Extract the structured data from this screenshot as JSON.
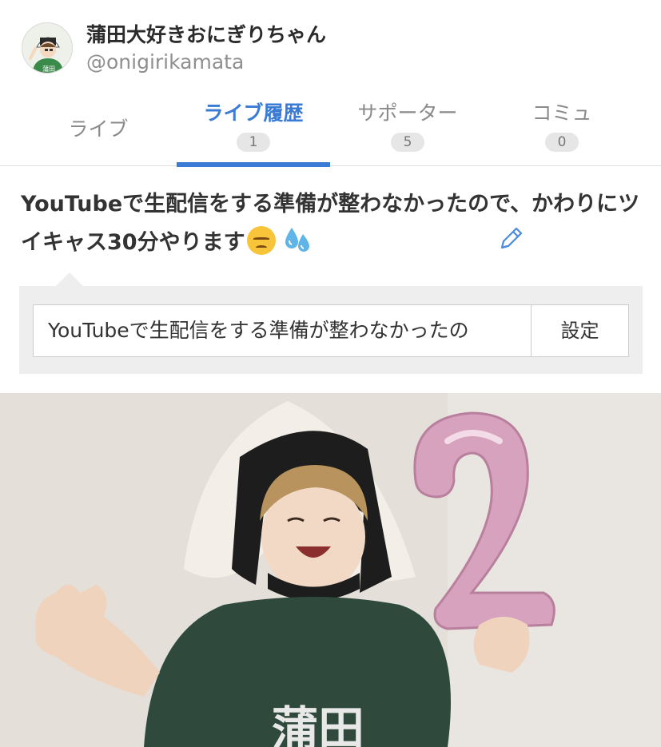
{
  "user": {
    "name": "蒲田大好きおにぎりちゃん",
    "handle": "@onigirikamata",
    "avatar_icon": "onigiri-character-avatar",
    "avatar_shirt_text": "蒲田"
  },
  "tabs": [
    {
      "label": "ライブ",
      "count": null,
      "active": false
    },
    {
      "label": "ライブ履歴",
      "count": "1",
      "active": true
    },
    {
      "label": "サポーター",
      "count": "5",
      "active": false
    },
    {
      "label": "コミュ",
      "count": "0",
      "active": false
    }
  ],
  "status": {
    "text": "YouTubeで生配信をする準備が整わなかったので、かわりにツイキャス30分やります",
    "emojis": [
      "disappointed-face-emoji",
      "sweat-droplets-emoji"
    ],
    "edit_icon": "pencil-icon"
  },
  "edit": {
    "input_value": "YouTubeで生配信をする準備が整わなかったの",
    "button_label": "設定"
  },
  "live_thumbnail": {
    "shirt_text": "蒲田",
    "balloon_text": "2"
  },
  "colors": {
    "accent": "#3a7bd5",
    "tab_inactive": "#8a8a8a",
    "badge_bg": "#e6e6e6",
    "shirt": "#2f4a3c",
    "balloon": "#d7a2bd"
  }
}
